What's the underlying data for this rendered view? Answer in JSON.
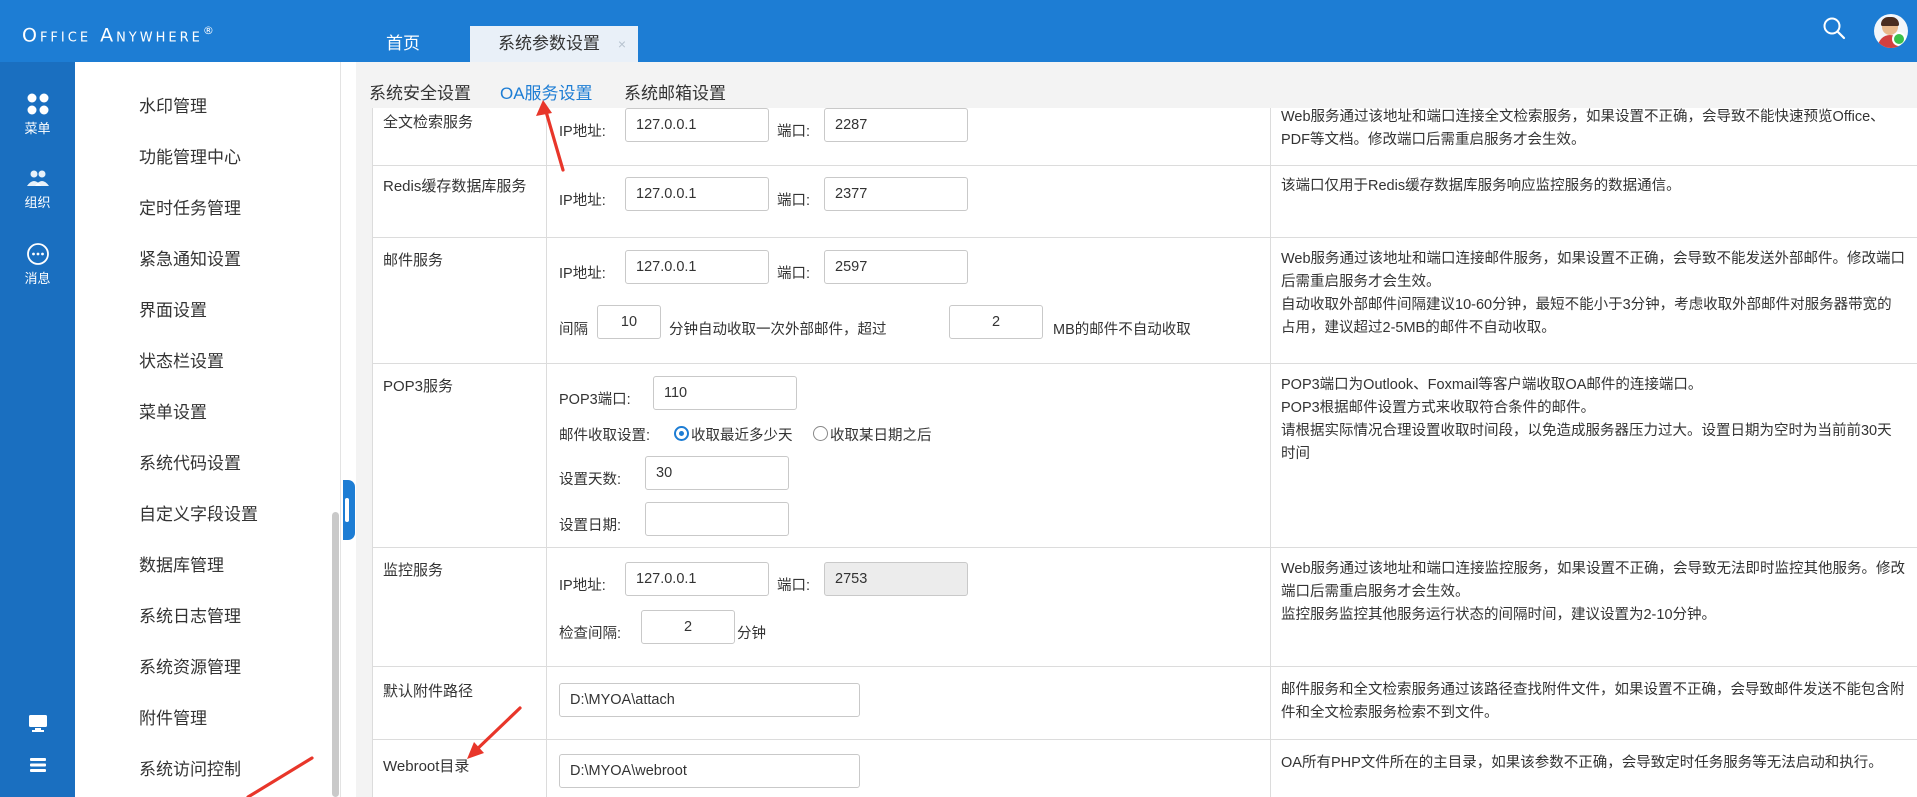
{
  "app": {
    "logo": "Office Anywhere",
    "logo_mark": "®"
  },
  "tabs": [
    {
      "label": "首页"
    },
    {
      "label": "系统参数设置",
      "close": "×"
    }
  ],
  "rail": {
    "items": [
      {
        "label": "菜单",
        "icon": "grid-icon"
      },
      {
        "label": "组织",
        "icon": "users-icon"
      },
      {
        "label": "消息",
        "icon": "chat-icon"
      },
      {
        "label": "",
        "icon": "monitor-icon"
      },
      {
        "label": "",
        "icon": "list-icon"
      }
    ]
  },
  "menu": {
    "items": [
      "水印管理",
      "功能管理中心",
      "定时任务管理",
      "紧急通知设置",
      "界面设置",
      "状态栏设置",
      "菜单设置",
      "系统代码设置",
      "自定义字段设置",
      "数据库管理",
      "系统日志管理",
      "系统资源管理",
      "附件管理",
      "系统访问控制"
    ]
  },
  "subtabs": [
    {
      "label": "系统安全设置"
    },
    {
      "label": "OA服务设置",
      "active": true
    },
    {
      "label": "系统邮箱设置"
    }
  ],
  "rows": {
    "fulltext": {
      "label": "全文检索服务",
      "ip_label": "IP地址:",
      "ip": "127.0.0.1",
      "port_label": "端口:",
      "port": "2287",
      "desc": "Web服务通过该地址和端口连接全文检索服务，如果设置不正确，会导致不能快速预览Office、PDF等文档。修改端口后需重启服务才会生效。"
    },
    "redis": {
      "label": "Redis缓存数据库服务",
      "ip_label": "IP地址:",
      "ip": "127.0.0.1",
      "port_label": "端口:",
      "port": "2377",
      "desc": "该端口仅用于Redis缓存数据库服务响应监控服务的数据通信。"
    },
    "mail": {
      "label": "邮件服务",
      "ip_label": "IP地址:",
      "ip": "127.0.0.1",
      "port_label": "端口:",
      "port": "2597",
      "interval_label": "间隔",
      "interval": "10",
      "interval_text": "分钟自动收取一次外部邮件，超过",
      "size": "2",
      "size_text": "MB的邮件不自动收取",
      "desc1": "Web服务通过该地址和端口连接邮件服务，如果设置不正确，会导致不能发送外部邮件。修改端口后需重启服务才会生效。",
      "desc2": "自动收取外部邮件间隔建议10-60分钟，最短不能小于3分钟，考虑收取外部邮件对服务器带宽的占用，建议超过2-5MB的邮件不自动收取。"
    },
    "pop3": {
      "label": "POP3服务",
      "port_label": "POP3端口:",
      "port": "110",
      "recv_label": "邮件收取设置:",
      "opt1": "收取最近多少天",
      "opt2": "收取某日期之后",
      "days_label": "设置天数:",
      "days": "30",
      "date_label": "设置日期:",
      "date": "",
      "desc1": "POP3端口为Outlook、Foxmail等客户端收取OA邮件的连接端口。",
      "desc2": "POP3根据邮件设置方式来收取符合条件的邮件。",
      "desc3": "请根据实际情况合理设置收取时间段，以免造成服务器压力过大。设置日期为空时为当前前30天时间"
    },
    "monitor": {
      "label": "监控服务",
      "ip_label": "IP地址:",
      "ip": "127.0.0.1",
      "port_label": "端口:",
      "port": "2753",
      "check_label": "检查间隔:",
      "check": "2",
      "check_unit": "分钟",
      "desc1": "Web服务通过该地址和端口连接监控服务，如果设置不正确，会导致无法即时监控其他服务。修改端口后需重启服务才会生效。",
      "desc2": "监控服务监控其他服务运行状态的间隔时间，建议设置为2-10分钟。"
    },
    "attach": {
      "label": "默认附件路径",
      "path": "D:\\MYOA\\attach",
      "desc": "邮件服务和全文检索服务通过该路径查找附件文件，如果设置不正确，会导致邮件发送不能包含附件和全文检索服务检索不到文件。"
    },
    "webroot": {
      "label": "Webroot目录",
      "path": "D:\\MYOA\\webroot",
      "desc": "OA所有PHP文件所在的主目录，如果该参数不正确，会导致定时任务服务等无法启动和执行。"
    }
  },
  "colors": {
    "header": "#1d7dd4",
    "rail": "#1a6fc0",
    "accent": "#1d7dd4",
    "arrow": "#e8362a"
  }
}
